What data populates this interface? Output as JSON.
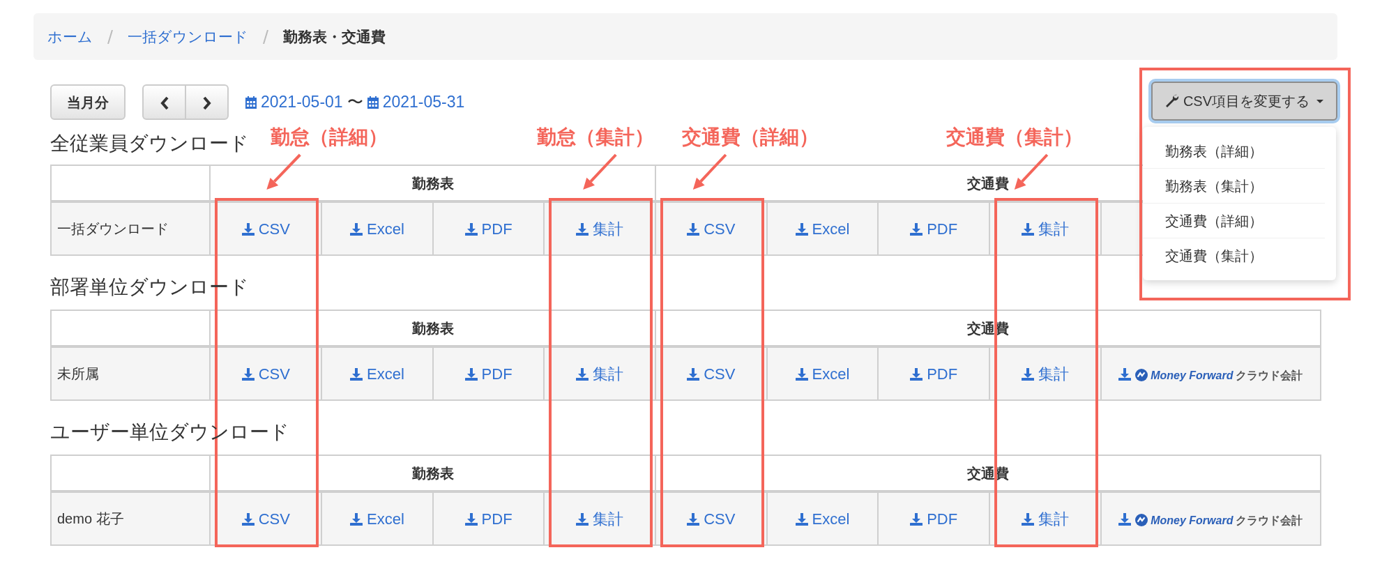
{
  "breadcrumb": [
    {
      "label": "ホーム",
      "link": true
    },
    {
      "label": "一括ダウンロード",
      "link": true
    },
    {
      "label": "勤務表・交通費",
      "link": false
    }
  ],
  "toolbar": {
    "current_month": "当月分",
    "date_from": "2021-05-01",
    "range_separator": "〜",
    "date_to": "2021-05-31"
  },
  "csv_menu": {
    "button": "CSV項目を変更する",
    "expanded": true,
    "items": [
      "勤務表（詳細）",
      "勤務表（集計）",
      "交通費（詳細）",
      "交通費（集計）"
    ]
  },
  "sections": [
    {
      "title": "全従業員ダウンロード",
      "groups": [
        {
          "label": "勤務表",
          "links": [
            {
              "kind": "file",
              "label": "CSV"
            },
            {
              "kind": "file",
              "label": "Excel"
            },
            {
              "kind": "file",
              "label": "PDF"
            },
            {
              "kind": "file",
              "label": "集計"
            }
          ]
        },
        {
          "label": "交通費",
          "links": [
            {
              "kind": "file",
              "label": "CSV"
            },
            {
              "kind": "file",
              "label": "Excel"
            },
            {
              "kind": "file",
              "label": "PDF"
            },
            {
              "kind": "file",
              "label": "集計"
            },
            {
              "kind": "blank"
            }
          ]
        }
      ],
      "row": "一括ダウンロード"
    },
    {
      "title": "部署単位ダウンロード",
      "groups": [
        {
          "label": "勤務表",
          "links": [
            {
              "kind": "file",
              "label": "CSV"
            },
            {
              "kind": "file",
              "label": "Excel"
            },
            {
              "kind": "file",
              "label": "PDF"
            },
            {
              "kind": "file",
              "label": "集計"
            }
          ]
        },
        {
          "label": "交通費",
          "links": [
            {
              "kind": "file",
              "label": "CSV"
            },
            {
              "kind": "file",
              "label": "Excel"
            },
            {
              "kind": "file",
              "label": "PDF"
            },
            {
              "kind": "file",
              "label": "集計"
            },
            {
              "kind": "brand",
              "brand": "Money Forward",
              "label": "クラウド会計"
            }
          ]
        }
      ],
      "row": "未所属"
    },
    {
      "title": "ユーザー単位ダウンロード",
      "groups": [
        {
          "label": "勤務表",
          "links": [
            {
              "kind": "file",
              "label": "CSV"
            },
            {
              "kind": "file",
              "label": "Excel"
            },
            {
              "kind": "file",
              "label": "PDF"
            },
            {
              "kind": "file",
              "label": "集計"
            }
          ]
        },
        {
          "label": "交通費",
          "links": [
            {
              "kind": "file",
              "label": "CSV"
            },
            {
              "kind": "file",
              "label": "Excel"
            },
            {
              "kind": "file",
              "label": "PDF"
            },
            {
              "kind": "file",
              "label": "集計"
            },
            {
              "kind": "brand",
              "brand": "Money Forward",
              "label": "クラウド会計"
            }
          ]
        }
      ],
      "row": "demo 花子"
    }
  ],
  "annotations": [
    {
      "label": "勤怠（詳細）"
    },
    {
      "label": "勤怠（集計）"
    },
    {
      "label": "交通費（詳細）"
    },
    {
      "label": "交通費（集計）"
    }
  ]
}
